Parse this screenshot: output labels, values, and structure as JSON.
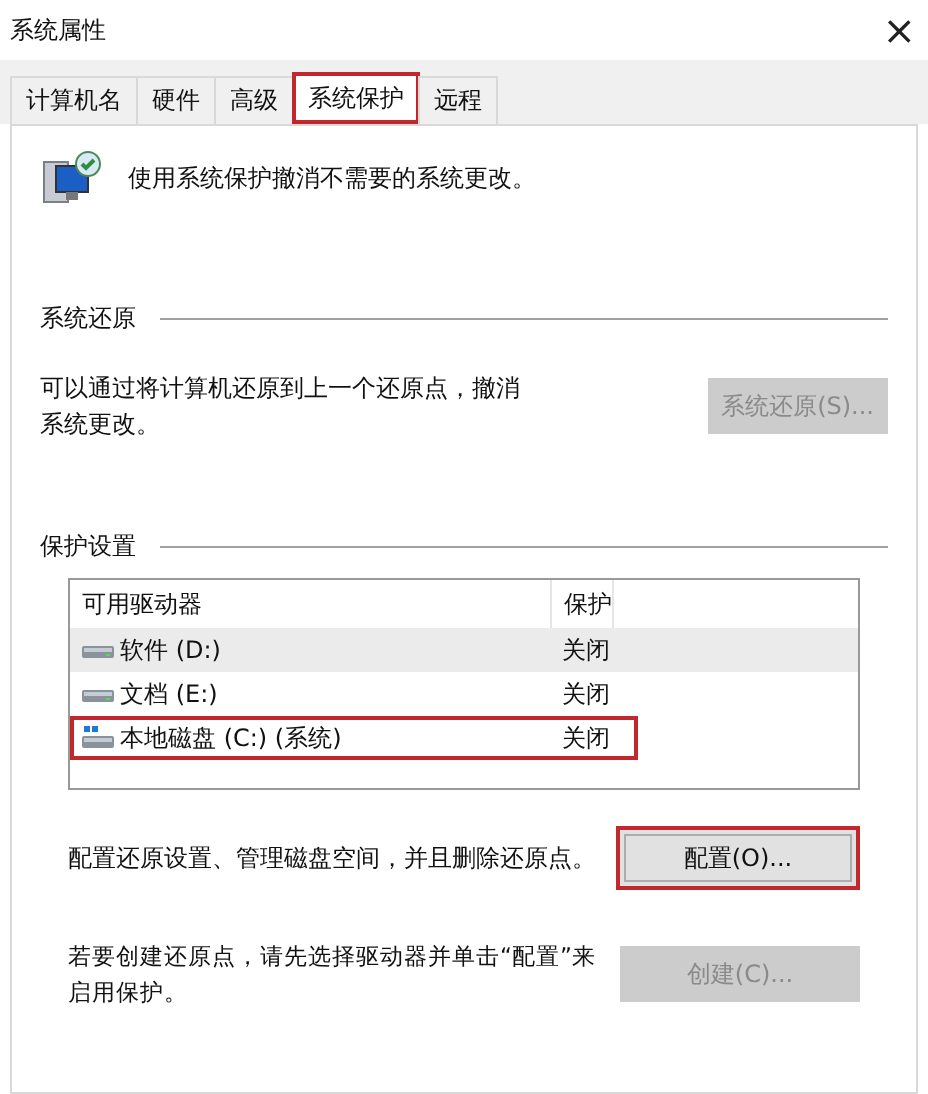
{
  "window": {
    "title": "系统属性",
    "close": "×"
  },
  "tabs": [
    {
      "label": "计算机名",
      "selected": false,
      "highlighted": false
    },
    {
      "label": "硬件",
      "selected": false,
      "highlighted": false
    },
    {
      "label": "高级",
      "selected": false,
      "highlighted": false
    },
    {
      "label": "系统保护",
      "selected": true,
      "highlighted": true
    },
    {
      "label": "远程",
      "selected": false,
      "highlighted": false
    }
  ],
  "intro": "使用系统保护撤消不需要的系统更改。",
  "restore_section": {
    "title": "系统还原",
    "text": "可以通过将计算机还原到上一个还原点，撤消系统更改。",
    "button": {
      "label": "系统还原(S)...",
      "disabled": true,
      "highlighted": false
    }
  },
  "protection_section": {
    "title": "保护设置",
    "columns": [
      "可用驱动器",
      "保护"
    ],
    "rows": [
      {
        "drive": "软件 (D:)",
        "protection": "关闭",
        "kind": "drive",
        "selected": true,
        "highlighted": false
      },
      {
        "drive": "文档 (E:)",
        "protection": "关闭",
        "kind": "drive",
        "selected": false,
        "highlighted": false
      },
      {
        "drive": "本地磁盘 (C:) (系统)",
        "protection": "关闭",
        "kind": "system",
        "selected": false,
        "highlighted": true
      }
    ],
    "configure": {
      "text": "配置还原设置、管理磁盘空间，并且删除还原点。",
      "button": {
        "label": "配置(O)...",
        "disabled": false,
        "highlighted": true
      }
    },
    "create": {
      "text": "若要创建还原点，请先选择驱动器并单击“配置”来启用保护。",
      "button": {
        "label": "创建(C)...",
        "disabled": true,
        "highlighted": false
      }
    }
  }
}
